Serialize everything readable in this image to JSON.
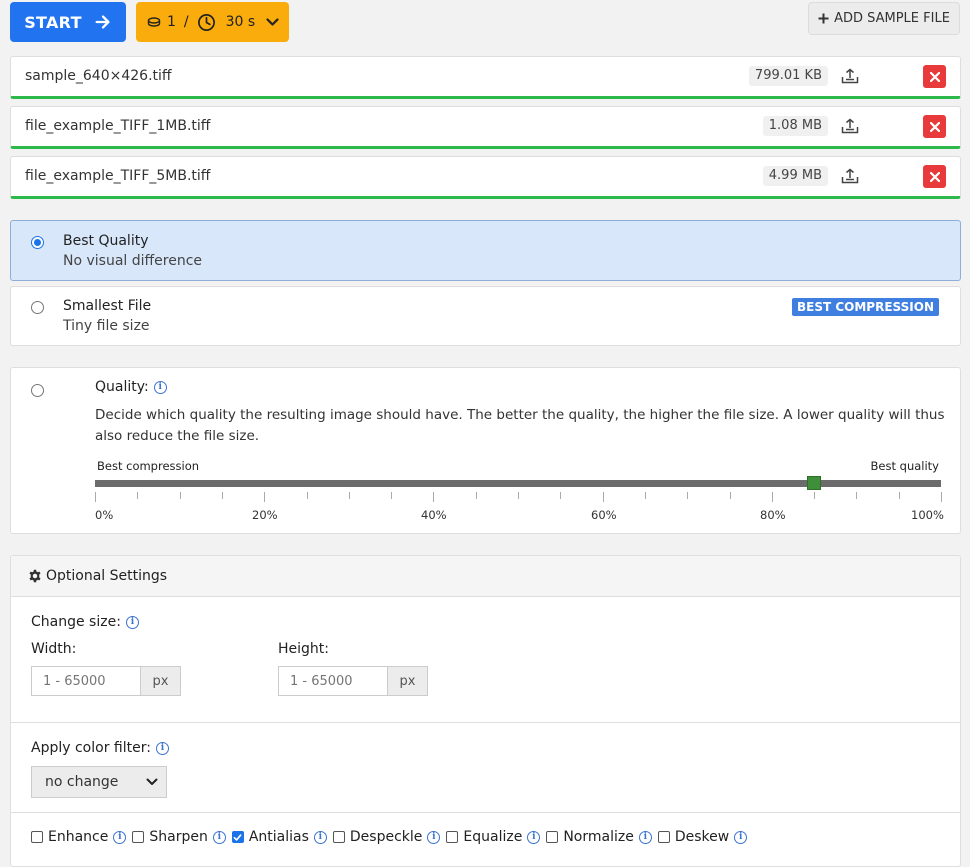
{
  "toolbar": {
    "start_label": "START",
    "credits_count": "1",
    "credits_separator": "/",
    "credits_time": "30 s",
    "add_sample_label": "ADD SAMPLE FILE"
  },
  "files": [
    {
      "name": "sample_640×426.tiff",
      "size": "799.01 KB",
      "progress": 1.0
    },
    {
      "name": "file_example_TIFF_1MB.tiff",
      "size": "1.08 MB",
      "progress": 1.0
    },
    {
      "name": "file_example_TIFF_5MB.tiff",
      "size": "4.99 MB",
      "progress": 1.0
    }
  ],
  "compression_options": [
    {
      "title": "Best Quality",
      "subtitle": "No visual difference",
      "selected": true
    },
    {
      "title": "Smallest File",
      "subtitle": "Tiny file size",
      "badge": "BEST COMPRESSION",
      "selected": false
    }
  ],
  "quality": {
    "title": "Quality:",
    "description": "Decide which quality the resulting image should have. The better the quality, the higher the file size. A lower quality will thus also reduce the file size.",
    "left_label": "Best compression",
    "right_label": "Best quality",
    "value_percent": 85,
    "tick_labels": [
      "0%",
      "20%",
      "40%",
      "60%",
      "80%",
      "100%"
    ]
  },
  "optional_settings": {
    "header": "Optional Settings",
    "change_size_label": "Change size:",
    "width_label": "Width:",
    "height_label": "Height:",
    "width_placeholder": "1 - 65000",
    "height_placeholder": "1 - 65000",
    "unit": "px",
    "color_filter_label": "Apply color filter:",
    "color_filter_value": "no change",
    "filters": [
      {
        "label": "Enhance",
        "checked": false
      },
      {
        "label": "Sharpen",
        "checked": false
      },
      {
        "label": "Antialias",
        "checked": true
      },
      {
        "label": "Despeckle",
        "checked": false
      },
      {
        "label": "Equalize",
        "checked": false
      },
      {
        "label": "Normalize",
        "checked": false
      },
      {
        "label": "Deskew",
        "checked": false
      }
    ]
  },
  "colors": {
    "primary": "#2173f0",
    "credits": "#f9ac0b",
    "progress": "#2cb84a",
    "delete": "#e8393b",
    "selected_bg": "#d9e7fb",
    "badge": "#3f7fe0",
    "slider_thumb": "#3f8f3a"
  }
}
